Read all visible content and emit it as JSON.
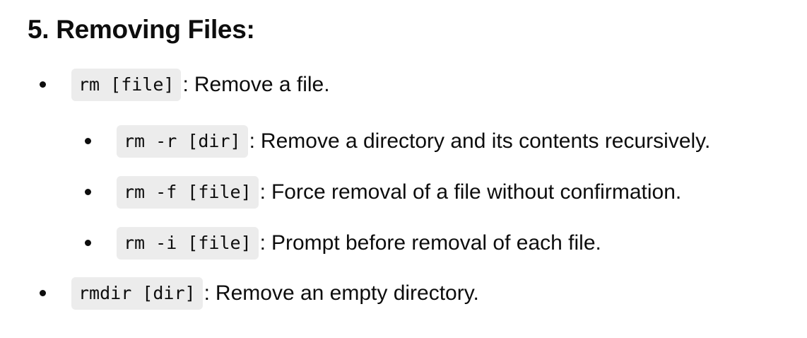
{
  "heading": "5. Removing Files:",
  "list": [
    {
      "command": "rm [file]",
      "description": "Remove a file.",
      "children": [
        {
          "command": "rm -r [dir]",
          "description": "Remove a directory and its contents recursively."
        },
        {
          "command": "rm -f [file]",
          "description": "Force removal of a file without confirmation."
        },
        {
          "command": "rm -i [file]",
          "description": "Prompt before removal of each file."
        }
      ]
    },
    {
      "command": "rmdir [dir]",
      "description": "Remove an empty directory."
    }
  ],
  "separator": ":"
}
